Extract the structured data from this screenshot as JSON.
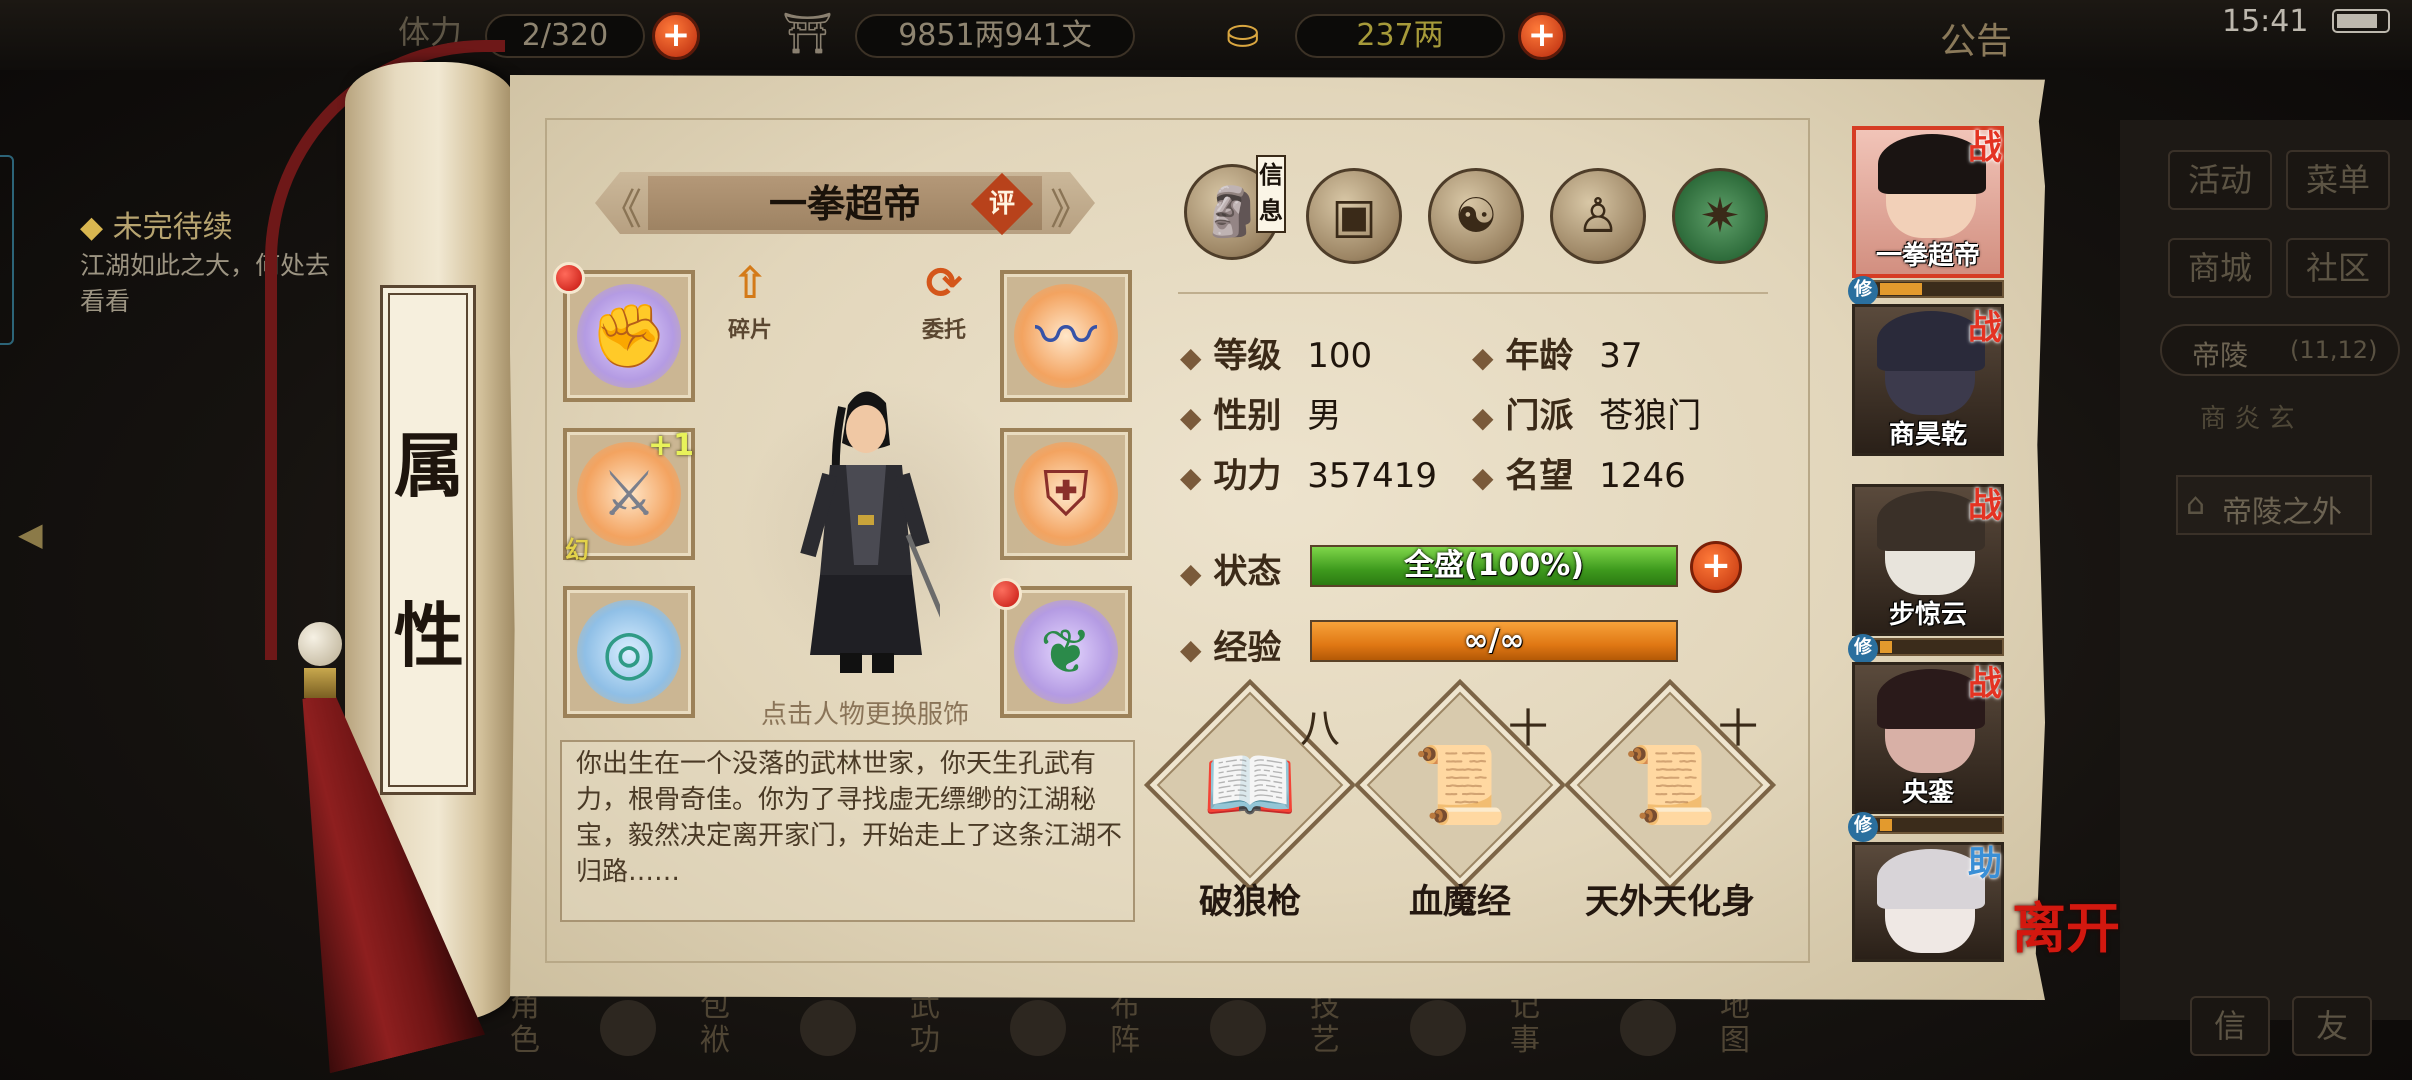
{
  "topbar": {
    "stamina_label": "体力",
    "stamina_value": "2/320",
    "silver_value": "9851两941文",
    "gold_value": "237两",
    "notice_label": "公告",
    "time": "15:41"
  },
  "quest": {
    "title": "未完待续",
    "text": "江湖如此之大，何处去看看"
  },
  "bottom_nav": [
    {
      "label": "角色"
    },
    {
      "label": "包袱"
    },
    {
      "label": "武功"
    },
    {
      "label": "布阵"
    },
    {
      "label": "技艺"
    },
    {
      "label": "记事"
    },
    {
      "label": "地图"
    }
  ],
  "right_menu": {
    "activity": "活动",
    "menu": "菜单",
    "mall": "商城",
    "community": "社区",
    "location": "帝陵",
    "coords": "(11,12)",
    "sub_location": "商 炎 玄",
    "exit_area": "帝陵之外",
    "bottom_btn1": "信",
    "bottom_btn2": "友"
  },
  "scroll_title": [
    "属",
    "性"
  ],
  "character": {
    "name": "一拳超帝",
    "eval_label": "评",
    "fragment_label": "碎片",
    "entrust_label": "委托",
    "outfit_hint": "点击人物更换服饰",
    "bio": "你出生在一个没落的武林世家，你天生孔武有力，根骨奇佳。你为了寻找虚无缥缈的江湖秘宝，毅然决定离开家门，开始走上了这条江湖不归路……",
    "plus_one": "+1",
    "phantom": "幻"
  },
  "info_tab_label": "信息",
  "stats": {
    "level_label": "等级",
    "level": "100",
    "age_label": "年龄",
    "age": "37",
    "gender_label": "性别",
    "gender": "男",
    "sect_label": "门派",
    "sect": "苍狼门",
    "power_label": "功力",
    "power": "357419",
    "fame_label": "名望",
    "fame": "1246",
    "status_label": "状态",
    "status_text": "全盛(100%)",
    "status_fraction": 1.0,
    "exp_label": "经验",
    "exp_text": "∞/∞",
    "exp_fraction": 1.0
  },
  "skills": [
    {
      "name": "破狼枪",
      "mark": "八"
    },
    {
      "name": "血魔经",
      "mark": "十"
    },
    {
      "name": "天外天化身",
      "mark": "十"
    }
  ],
  "party": [
    {
      "name": "一拳超帝",
      "tag": "战",
      "xiu": "修",
      "xiu_fraction": 0.35
    },
    {
      "name": "商昊乾",
      "tag": "战"
    },
    {
      "name": "步惊云",
      "tag": "战",
      "xiu": "修",
      "xiu_fraction": 0.1
    },
    {
      "name": "央銮",
      "tag": "战",
      "xiu": "修",
      "xiu_fraction": 0.1
    },
    {
      "name": "",
      "tag": "助"
    }
  ],
  "leave_label": "离开",
  "colors": {
    "status_bar": "#3e9a1d",
    "exp_bar": "#e07814",
    "accent_red": "#d3180f",
    "paper": "#e6dbc2"
  }
}
